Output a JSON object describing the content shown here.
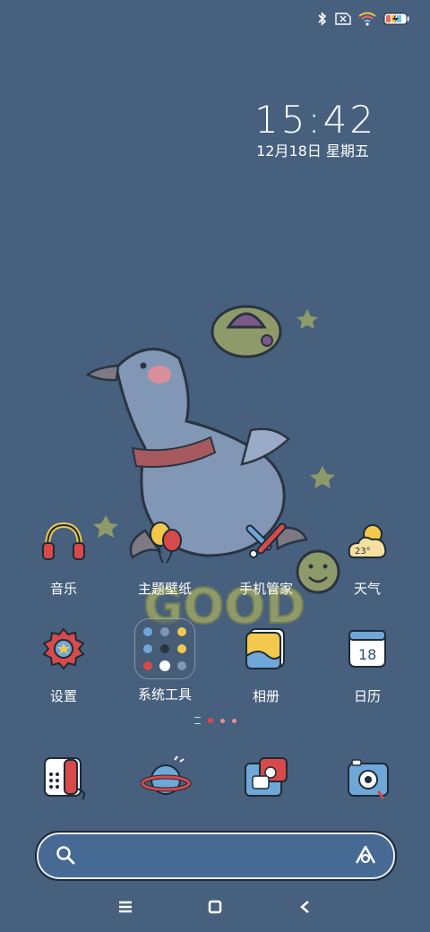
{
  "status_bar": {
    "icons": [
      "bluetooth-icon",
      "sim-off-icon",
      "wifi-icon",
      "battery-charging-icon"
    ]
  },
  "clock": {
    "time": "15:42",
    "date": "12月18日 星期五"
  },
  "apps_row1": [
    {
      "label": "音乐",
      "icon": "headphones-icon"
    },
    {
      "label": "主题壁纸",
      "icon": "balloons-icon"
    },
    {
      "label": "手机管家",
      "icon": "tools-icon"
    },
    {
      "label": "天气",
      "icon": "weather-icon",
      "badge": "23°"
    }
  ],
  "apps_row2": [
    {
      "label": "设置",
      "icon": "gear-icon"
    },
    {
      "label": "系统工具",
      "icon": "folder-icon"
    },
    {
      "label": "相册",
      "icon": "gallery-icon"
    },
    {
      "label": "日历",
      "icon": "calendar-icon",
      "badge": "18"
    }
  ],
  "dock": [
    {
      "icon": "phone-icon"
    },
    {
      "icon": "browser-planet-icon"
    },
    {
      "icon": "messages-icon"
    },
    {
      "icon": "camera-icon"
    }
  ],
  "wallpaper": {
    "text": "GOOD"
  },
  "colors": {
    "background": "#46607e",
    "accent_red": "#d84a4a",
    "accent_yellow": "#f2c94c"
  }
}
